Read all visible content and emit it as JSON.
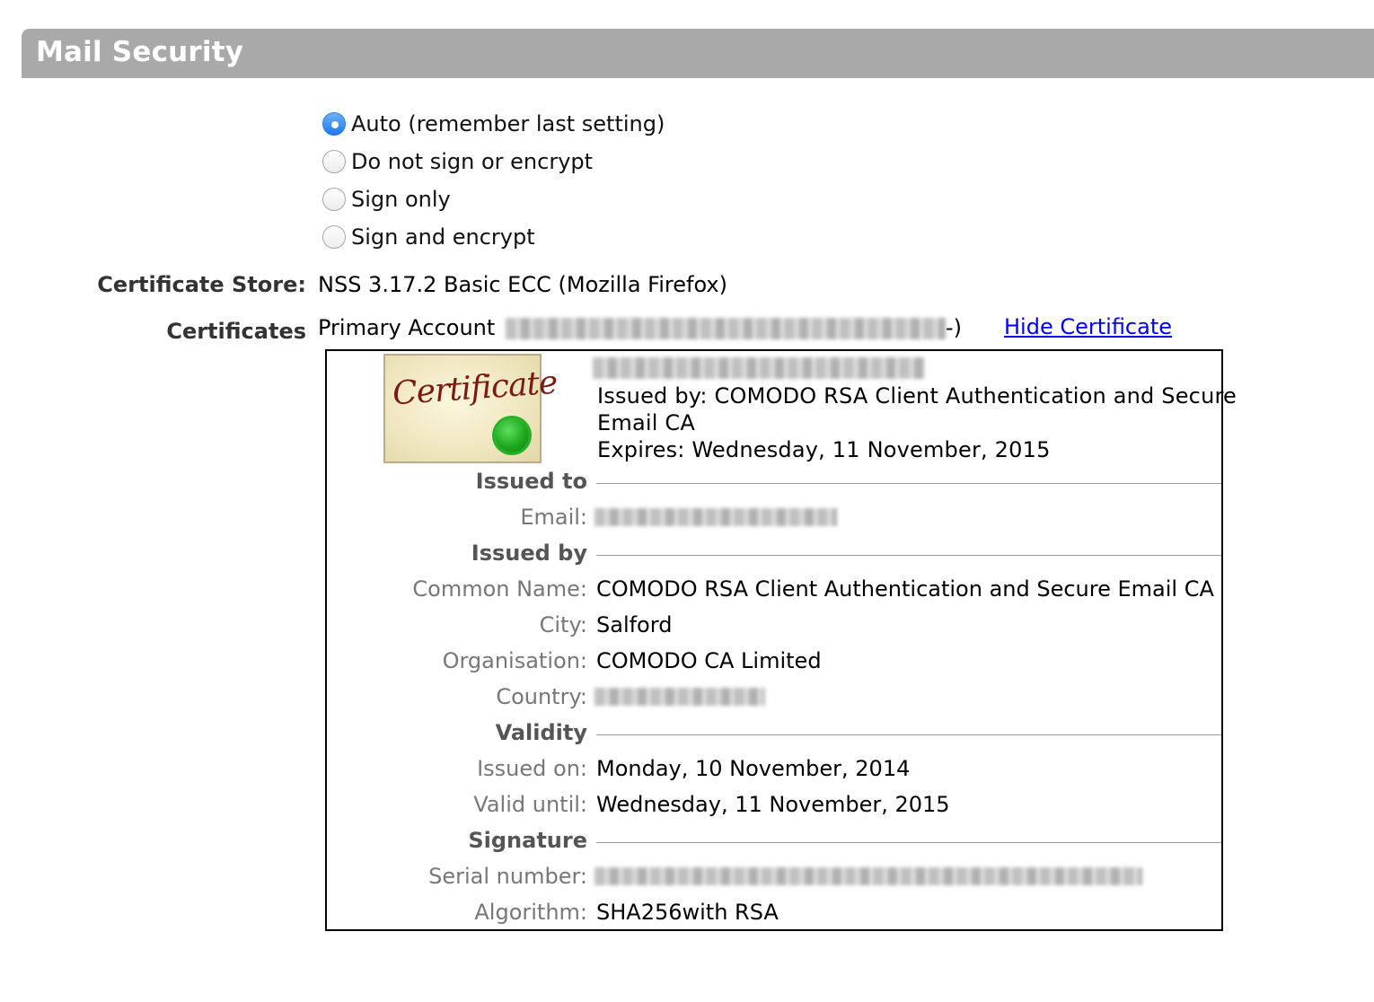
{
  "header": {
    "title": "Mail Security"
  },
  "security_options": [
    {
      "label": "Auto (remember last setting)",
      "selected": true
    },
    {
      "label": "Do not sign or encrypt",
      "selected": false
    },
    {
      "label": "Sign only",
      "selected": false
    },
    {
      "label": "Sign and encrypt",
      "selected": false
    }
  ],
  "certificate_store": {
    "label": "Certificate Store:",
    "value": "NSS 3.17.2 Basic ECC (Mozilla Firefox)"
  },
  "certificates": {
    "label": "Certificates",
    "account_prefix": "Primary Account",
    "account_suffix": "-)",
    "hide_link": "Hide Certificate"
  },
  "certificate": {
    "image_text": "Certificate",
    "issued_by_summary_1": "Issued by: COMODO RSA Client Authentication and Secure",
    "issued_by_summary_2": "Email CA",
    "expires_summary": "Expires: Wednesday, 11 November, 2015",
    "sections": {
      "issued_to": "Issued to",
      "issued_by": "Issued by",
      "validity": "Validity",
      "signature": "Signature"
    },
    "fields": {
      "email_label": "Email:",
      "common_name_label": "Common Name:",
      "common_name": "COMODO RSA Client Authentication and Secure Email CA",
      "city_label": "City:",
      "city": "Salford",
      "organisation_label": "Organisation:",
      "organisation": "COMODO CA Limited",
      "country_label": "Country:",
      "issued_on_label": "Issued on:",
      "issued_on": "Monday, 10 November, 2014",
      "valid_until_label": "Valid until:",
      "valid_until": "Wednesday, 11 November, 2015",
      "serial_label": "Serial number:",
      "algorithm_label": "Algorithm:",
      "algorithm": "SHA256with RSA"
    }
  }
}
